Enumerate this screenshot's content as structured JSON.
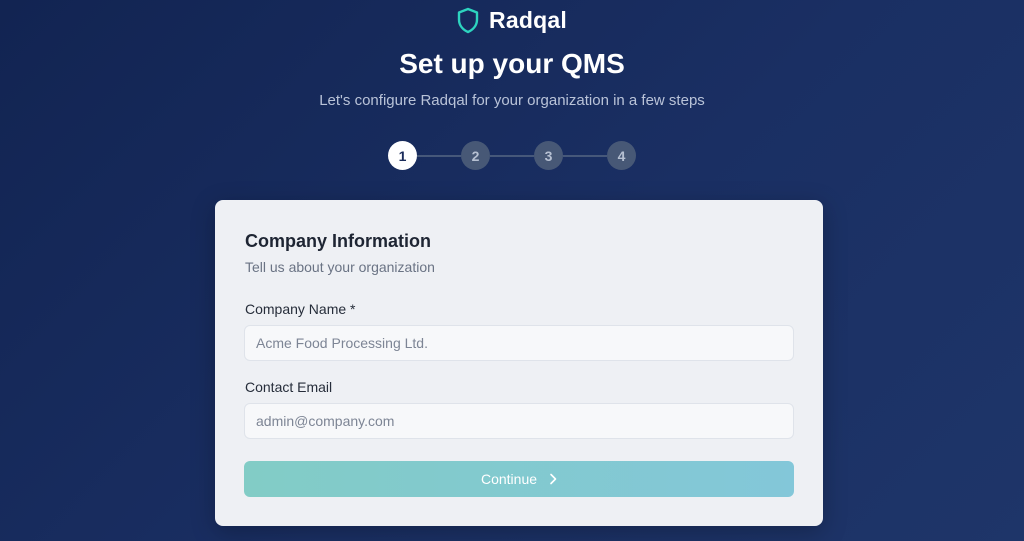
{
  "brand": {
    "name": "Radqal",
    "logo_icon": "shield-icon",
    "accent_color": "#2dd4bf"
  },
  "header": {
    "title": "Set up your QMS",
    "subtitle": "Let's configure Radqal for your organization in a few steps"
  },
  "stepper": {
    "current_step": 1,
    "steps": [
      "1",
      "2",
      "3",
      "4"
    ]
  },
  "form": {
    "title": "Company Information",
    "subtitle": "Tell us about your organization",
    "company_name": {
      "label": "Company Name *",
      "value": "",
      "placeholder": "Acme Food Processing Ltd."
    },
    "contact_email": {
      "label": "Contact Email",
      "value": "",
      "placeholder": "admin@company.com"
    },
    "continue_label": "Continue",
    "continue_icon": "chevron-right-icon"
  }
}
